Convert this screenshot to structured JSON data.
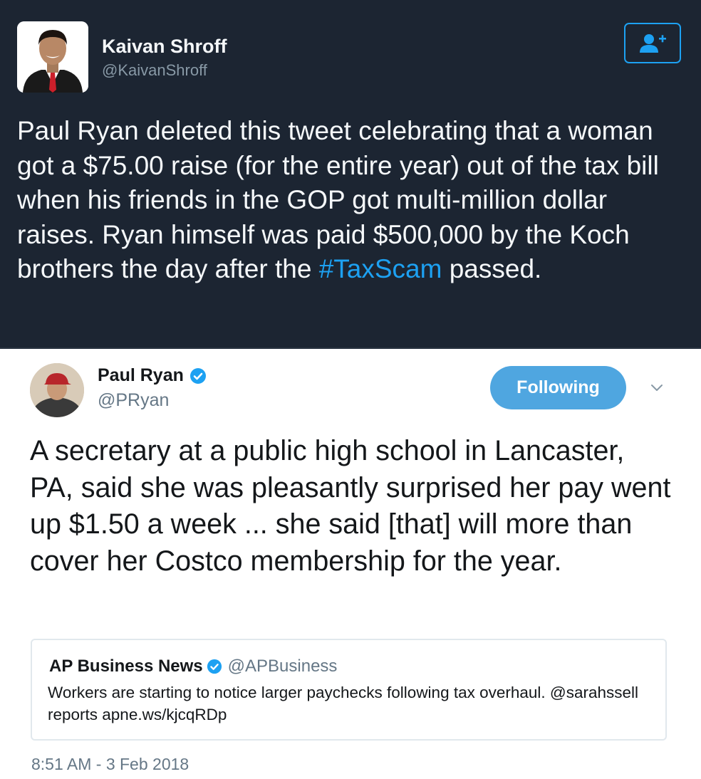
{
  "outer_tweet": {
    "author_name": "Kaivan Shroff",
    "author_handle": "@KaivanShroff",
    "follow_icon": "add-user-icon",
    "text_main": "Paul Ryan deleted this tweet celebrating that a woman got a $75.00 raise (for the entire year) out of the tax bill when his friends in the GOP got multi-million dollar raises. Ryan himself was paid $500,000 by the Koch brothers the day after the ",
    "hashtag": "#TaxScam",
    "text_end": " passed.",
    "colors": {
      "background": "#1c2532",
      "accent": "#1da1f2",
      "text": "#f5f8fa",
      "muted": "#8899a6"
    }
  },
  "embedded_tweet": {
    "author_name": "Paul Ryan",
    "author_handle": "@PRyan",
    "verified_icon": "verified-badge-icon",
    "following_label": "Following",
    "menu_icon": "chevron-down-icon",
    "text": "A secretary at a public high school in Lancaster, PA, said she was pleasantly surprised her pay went up $1.50 a week ... she said [that] will more than cover her Costco membership for the year.",
    "quote": {
      "author_name": "AP Business News",
      "author_handle": "@APBusiness",
      "text": "Workers are starting to notice larger paychecks following tax overhaul. @sarahssell reports apne.ws/kjcqRDp"
    },
    "timestamp": "8:51 AM - 3 Feb 2018",
    "colors": {
      "background": "#ffffff",
      "following_button": "#4fa6e0",
      "verified": "#1da1f2",
      "text": "#14171a",
      "muted": "#657786"
    }
  }
}
